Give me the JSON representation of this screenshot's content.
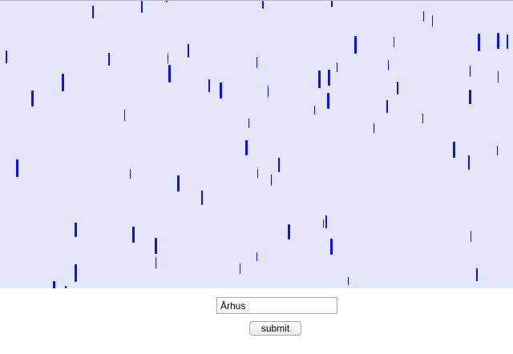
{
  "form": {
    "city_value": "Århus",
    "submit_label": "submit"
  },
  "colors": {
    "canvas_background": "#e6e6fa",
    "stroke_color": "#0a14e6"
  }
}
